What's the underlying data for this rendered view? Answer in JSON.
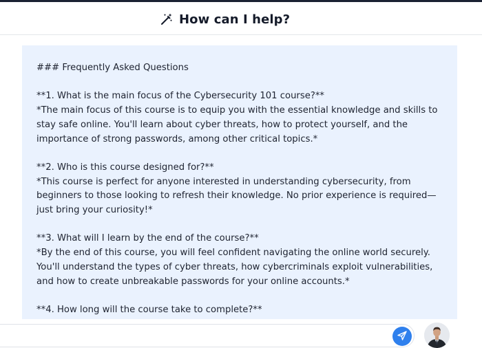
{
  "header": {
    "title": "How can I help?",
    "icon": "magic-wand-icon"
  },
  "faq": {
    "lines": [
      "### Frequently Asked Questions",
      "",
      "**1. What is the main focus of the Cybersecurity 101 course?**",
      "*The main focus of this course is to equip you with the essential knowledge and skills to stay safe online. You'll learn about cyber threats, how to protect yourself, and the importance of strong passwords, among other critical topics.*",
      "",
      "**2. Who is this course designed for?**",
      "*This course is perfect for anyone interested in understanding cybersecurity, from beginners to those looking to refresh their knowledge. No prior experience is required—just bring your curiosity!*",
      "",
      "**3. What will I learn by the end of the course?**",
      "*By the end of this course, you will feel confident navigating the online world securely. You'll understand the types of cyber threats, how cybercriminals exploit vulnerabilities, and how to create unbreakable passwords for your online accounts.*",
      "",
      "**4. How long will the course take to complete?**"
    ]
  },
  "composer": {
    "input_value": "",
    "send_icon": "send-icon",
    "avatar": "avatar-presenter"
  },
  "colors": {
    "panel_bg": "#eaf2fe",
    "send_button": "#2f80ed",
    "title": "#151b2a"
  }
}
